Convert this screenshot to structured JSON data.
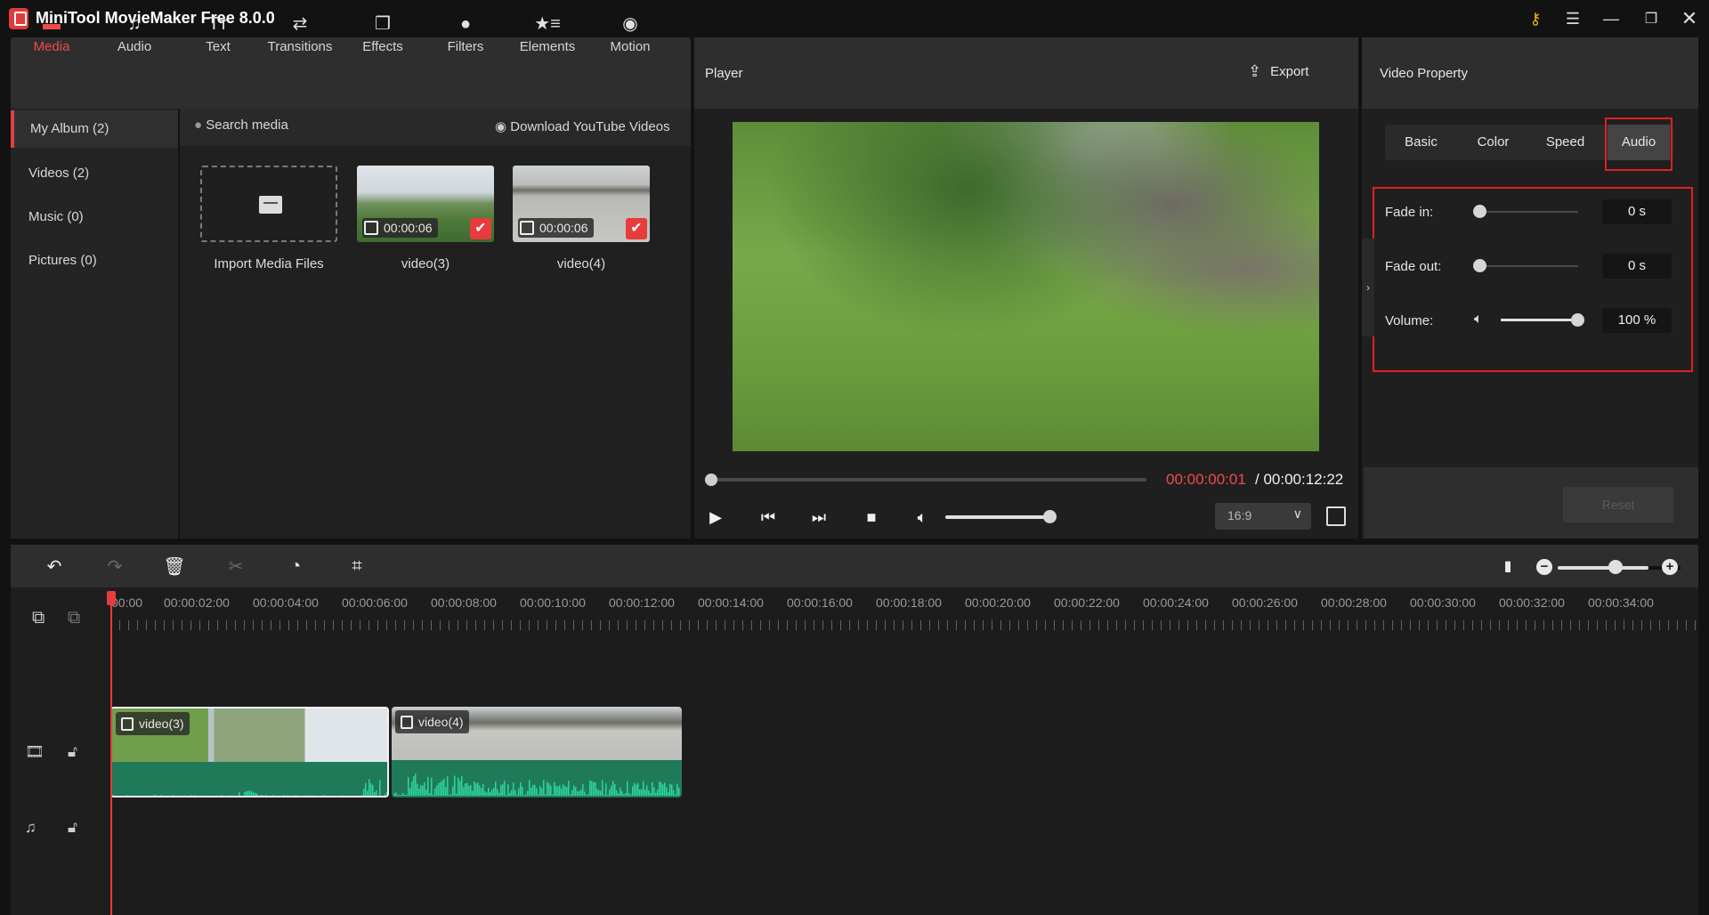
{
  "window": {
    "title": "MiniTool MovieMaker Free 8.0.0",
    "controls": [
      "key-icon",
      "menu-icon",
      "minimize-icon",
      "restore-icon",
      "close-icon"
    ]
  },
  "toolbar": {
    "items": [
      {
        "label": "Media",
        "icon": "folder-icon",
        "active": true
      },
      {
        "label": "Audio",
        "icon": "music-icon"
      },
      {
        "label": "Text",
        "icon": "text-icon"
      },
      {
        "label": "Transitions",
        "icon": "transitions-icon"
      },
      {
        "label": "Effects",
        "icon": "effects-icon"
      },
      {
        "label": "Filters",
        "icon": "filters-icon"
      },
      {
        "label": "Elements",
        "icon": "elements-icon"
      },
      {
        "label": "Motion",
        "icon": "motion-icon"
      }
    ]
  },
  "media": {
    "sidebar": [
      {
        "label": "My Album (2)",
        "active": true
      },
      {
        "label": "Videos (2)"
      },
      {
        "label": "Music (0)"
      },
      {
        "label": "Pictures (0)"
      }
    ],
    "search_label": "Search media",
    "download_label": "Download YouTube Videos",
    "import_label": "Import Media Files",
    "items": [
      {
        "name": "video(3)",
        "duration": "00:00:06",
        "selected": true
      },
      {
        "name": "video(4)",
        "duration": "00:00:06",
        "selected": true
      }
    ]
  },
  "player": {
    "title": "Player",
    "export_label": "Export",
    "current_time": "00:00:00:01",
    "total_time": "/ 00:00:12:22",
    "progress": 0.0,
    "volume": 1.0,
    "aspect_ratio": "16:9",
    "chevron": "⌄"
  },
  "property": {
    "title": "Video Property",
    "tabs": [
      {
        "label": "Basic"
      },
      {
        "label": "Color"
      },
      {
        "label": "Speed"
      },
      {
        "label": "Audio",
        "active": true
      }
    ],
    "fade_in": {
      "label": "Fade in:",
      "value": "0 s",
      "fraction": 0
    },
    "fade_out": {
      "label": "Fade out:",
      "value": "0 s",
      "fraction": 0
    },
    "volume": {
      "label": "Volume:",
      "value": "100 %",
      "fraction": 1.0
    },
    "reset_label": "Reset",
    "collapse_glyph": "›"
  },
  "timeline": {
    "zoom_level": 0.6,
    "ruler": [
      "00:00",
      "00:00:02:00",
      "00:00:04:00",
      "00:00:06:00",
      "00:00:08:00",
      "00:00:10:00",
      "00:00:12:00",
      "00:00:14:00",
      "00:00:16:00",
      "00:00:18:00",
      "00:00:20:00",
      "00:00:22:00",
      "00:00:24:00",
      "00:00:26:00",
      "00:00:28:00",
      "00:00:30:00",
      "00:00:32:00",
      "00:00:34:00"
    ],
    "clips": [
      {
        "name": "video(3)",
        "selected": true
      },
      {
        "name": "video(4)"
      }
    ],
    "playhead_time": "00:00:00:01"
  },
  "colors": {
    "accent": "#e83b3b",
    "waveform": "#2fd49a",
    "waveform_bg": "#1f7a5a",
    "highlight_box": "#e02020"
  }
}
